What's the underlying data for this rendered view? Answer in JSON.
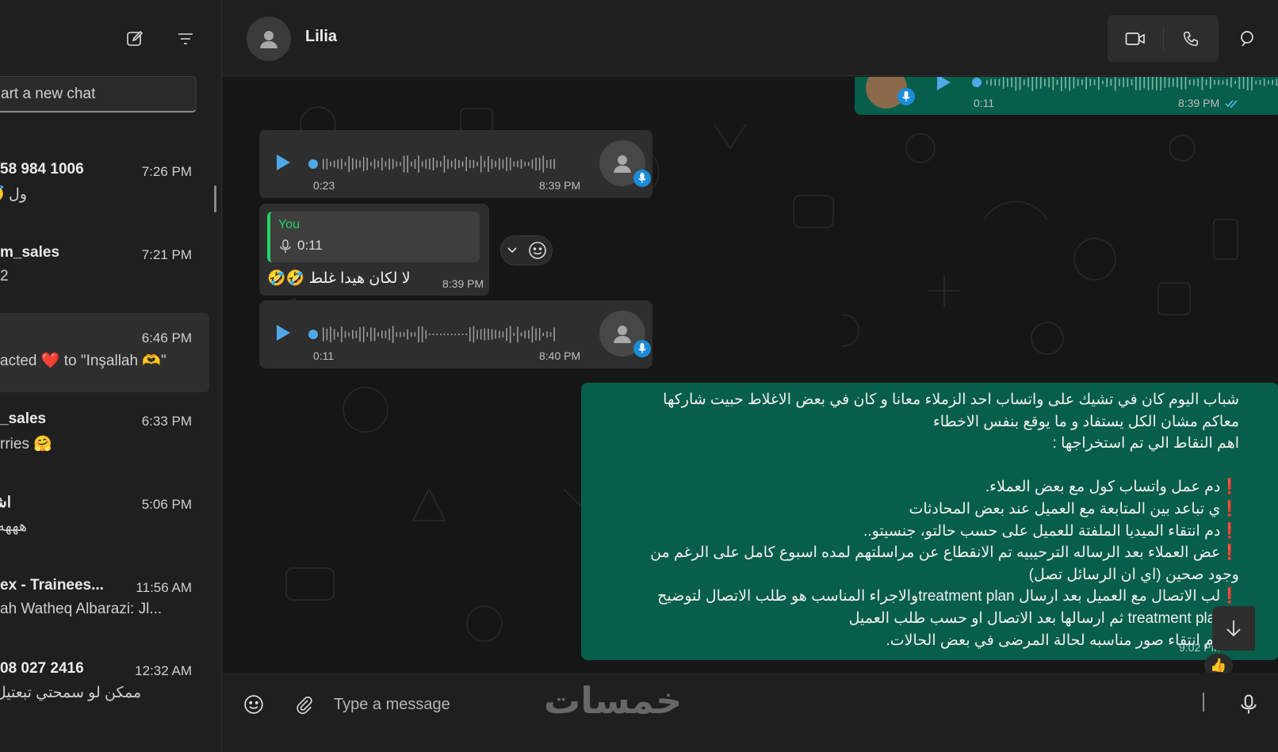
{
  "sidebar": {
    "search_placeholder": "art a new chat",
    "chats": [
      {
        "name": "58 984 1006",
        "time": "7:26 PM",
        "preview": "ول 😇"
      },
      {
        "name": "m_sales",
        "time": "7:21 PM",
        "preview": "2"
      },
      {
        "name": "",
        "time": "6:46 PM",
        "preview": "acted ❤️ to \"Inşallah 🫶\""
      },
      {
        "name": "_sales",
        "time": "6:33 PM",
        "preview": "rries 🤗"
      },
      {
        "name": "اشر",
        "time": "5:06 PM",
        "preview": "هههه ما"
      },
      {
        "name": "ex - Trainees...",
        "time": "11:56 AM",
        "preview": "ah Watheq Albarazi: Jl..."
      },
      {
        "name": "08 027 2416",
        "time": "12:32 AM",
        "preview": "ممكن لو سمحتي تبعتيل..."
      }
    ]
  },
  "header": {
    "contact_name": "Lilia"
  },
  "messages": {
    "top_voice": {
      "duration": "0:11",
      "time": "8:39 PM"
    },
    "voice1": {
      "duration": "0:23",
      "time": "8:39 PM"
    },
    "reply": {
      "quote_author": "You",
      "quote_text": "0:11",
      "text": "لا لكان هيدا غلط 🤣🤣",
      "time": "8:39 PM"
    },
    "voice2": {
      "duration": "0:11",
      "time": "8:40 PM"
    },
    "long": {
      "lines": [
        "شباب اليوم كان في تشيك على واتساب احد الزملاء معانا و كان في بعض الاغلاط حبيت شاركها",
        "معاكم مشان الكل يستفاد و ما يوقع بنفس الاخطاء",
        "اهم النقاط الي تم استخراجها :",
        "",
        "❗عدم عمل واتساب كول مع بعض العملاء.",
        "❗في تباعد بين المتابعة مع العميل عند بعض المحادثات",
        "❗عدم انتقاء الميديا الملفتة للعميل على حسب حالتو، جنسيتو..",
        "❗بعض العملاء بعد الرساله الترحيبيه تم الانقطاع عن مراسلتهم لمده اسبوع كامل على الرغم من",
        "وجود صحين (اي ان الرسائل تصل)",
        "❗طلب الاتصال مع العميل بعد ارسال treatment planوالاجراء المناسب هو طلب الاتصال لتوضيح",
        "الtreatment plan ثم ارسالها بعد الاتصال او حسب طلب العميل",
        "❗عدم انتقاء صور مناسبه لحالة المرضى في بعض الحالات."
      ],
      "time": "9:02 PM",
      "reaction": "👍"
    }
  },
  "composer": {
    "placeholder": "Type a message",
    "watermark": "خمسات"
  },
  "colors": {
    "outgoing_bubble": "#075e4a",
    "incoming_bubble": "#2e2e2e",
    "accent_green": "#25d366",
    "voice_blue": "#1a8cd8",
    "alert_red": "#ff3b30"
  }
}
